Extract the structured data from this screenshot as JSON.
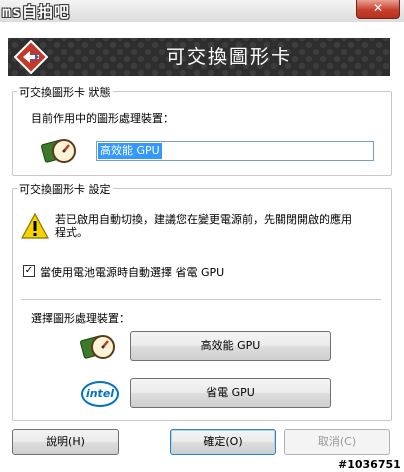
{
  "window": {
    "logo_text": "ms自拍吧",
    "close_label": "✕"
  },
  "banner": {
    "title": "可交換圖形卡"
  },
  "status_group": {
    "label": "可交換圖形卡 狀態",
    "current_processor_label": "目前作用中的圖形處理裝置：",
    "current_processor_value": "高效能 GPU"
  },
  "settings_group": {
    "label": "可交換圖形卡 設定",
    "warning_text_line1": "若已啟用自動切換，建議您在變更電源前，先關閉開啟的應用",
    "warning_text_line2": "程式。",
    "auto_switch_label": "當使用電池電源時自動選擇 省電 GPU",
    "auto_switch_checked": true,
    "select_processor_label": "選擇圖形處理裝置：",
    "high_performance_button": "高效能 GPU",
    "power_saving_button": "省電 GPU",
    "intel_logo_text": "intel"
  },
  "footer": {
    "help_button": "說明(H)",
    "ok_button": "確定(O)",
    "cancel_button": "取消(C)"
  },
  "watermark": "#1036751",
  "colors": {
    "banner_bg": "#2e2e2e",
    "selection": "#3399ff",
    "close_button": "#c7402d",
    "intel_blue": "#0071c5"
  }
}
